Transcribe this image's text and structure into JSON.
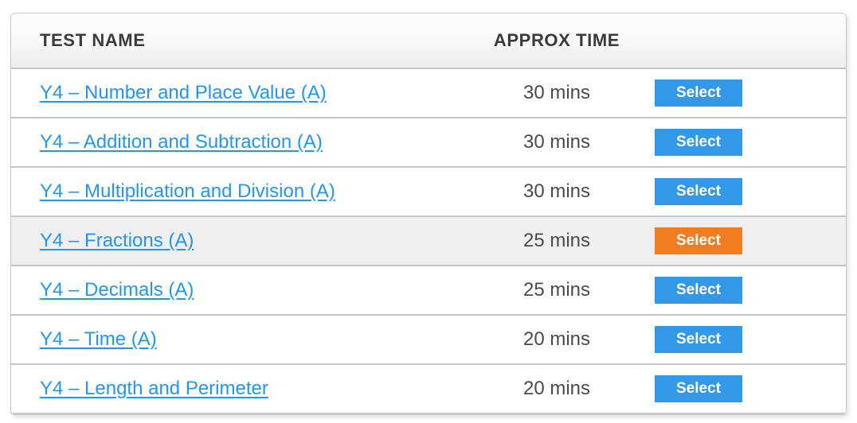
{
  "table": {
    "columns": [
      {
        "key": "name",
        "label": "TEST NAME"
      },
      {
        "key": "time",
        "label": "APPROX TIME"
      },
      {
        "key": "action",
        "label": ""
      }
    ],
    "rows": [
      {
        "name": "Y4 – Number and Place Value (A)",
        "time": "30 mins",
        "button": "Select",
        "highlighted": false,
        "accent": false
      },
      {
        "name": "Y4 – Addition and Subtraction (A)",
        "time": "30 mins",
        "button": "Select",
        "highlighted": false,
        "accent": false
      },
      {
        "name": "Y4 – Multiplication and Division (A)",
        "time": "30 mins",
        "button": "Select",
        "highlighted": false,
        "accent": false
      },
      {
        "name": "Y4 – Fractions (A)",
        "time": "25 mins",
        "button": "Select",
        "highlighted": true,
        "accent": true
      },
      {
        "name": "Y4 – Decimals (A)",
        "time": "25 mins",
        "button": "Select",
        "highlighted": false,
        "accent": false
      },
      {
        "name": "Y4 – Time (A)",
        "time": "20 mins",
        "button": "Select",
        "highlighted": false,
        "accent": false
      },
      {
        "name": "Y4 – Length and Perimeter",
        "time": "20 mins",
        "button": "Select",
        "highlighted": false,
        "accent": false
      }
    ]
  },
  "colors": {
    "link": "#2196f3",
    "button_default": "#3498e8",
    "button_accent": "#f07d21",
    "row_highlight": "#efefef",
    "header_text": "#3b3b3b",
    "border": "#c6c6c6"
  }
}
